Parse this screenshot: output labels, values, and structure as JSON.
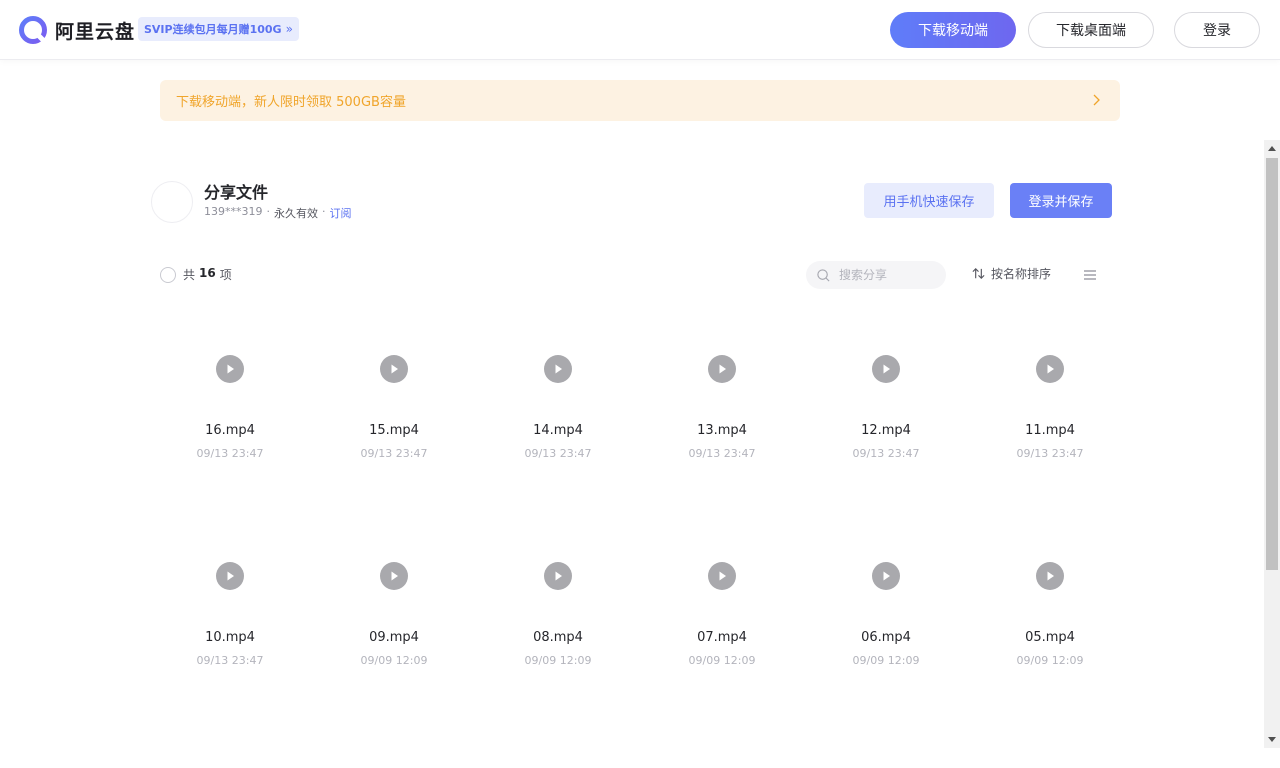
{
  "header": {
    "logo_text": "阿里云盘",
    "svip_badge": "SVIP连续包月每月赠100G",
    "download_mobile": "下载移动端",
    "download_desktop": "下载桌面端",
    "login": "登录",
    "colors": {
      "brand": "#5b72f1",
      "gradient_start": "#5f7df9",
      "gradient_end": "#6e67ef"
    }
  },
  "banner": {
    "text": "下载移动端，新人限时领取 500GB容量",
    "icon": "chevron-right-icon",
    "color": "#f0a52b"
  },
  "share": {
    "title": "分享文件",
    "owner": "139***319",
    "separator": "·",
    "validity": "永久有效",
    "subscribe": "订阅",
    "save_by_phone": "用手机快速保存",
    "login_and_save": "登录并保存"
  },
  "toolbar": {
    "count_prefix": "共",
    "count_value": "16",
    "count_suffix": "项",
    "search_placeholder": "搜索分享",
    "sort_label": "按名称排序",
    "icons": [
      "search-icon",
      "sort-icon",
      "list-view-icon"
    ]
  },
  "files": [
    {
      "name": "16.mp4",
      "date": "09/13 23:47"
    },
    {
      "name": "15.mp4",
      "date": "09/13 23:47"
    },
    {
      "name": "14.mp4",
      "date": "09/13 23:47"
    },
    {
      "name": "13.mp4",
      "date": "09/13 23:47"
    },
    {
      "name": "12.mp4",
      "date": "09/13 23:47"
    },
    {
      "name": "11.mp4",
      "date": "09/13 23:47"
    },
    {
      "name": "10.mp4",
      "date": "09/13 23:47"
    },
    {
      "name": "09.mp4",
      "date": "09/09 12:09"
    },
    {
      "name": "08.mp4",
      "date": "09/09 12:09"
    },
    {
      "name": "07.mp4",
      "date": "09/09 12:09"
    },
    {
      "name": "06.mp4",
      "date": "09/09 12:09"
    },
    {
      "name": "05.mp4",
      "date": "09/09 12:09"
    }
  ]
}
